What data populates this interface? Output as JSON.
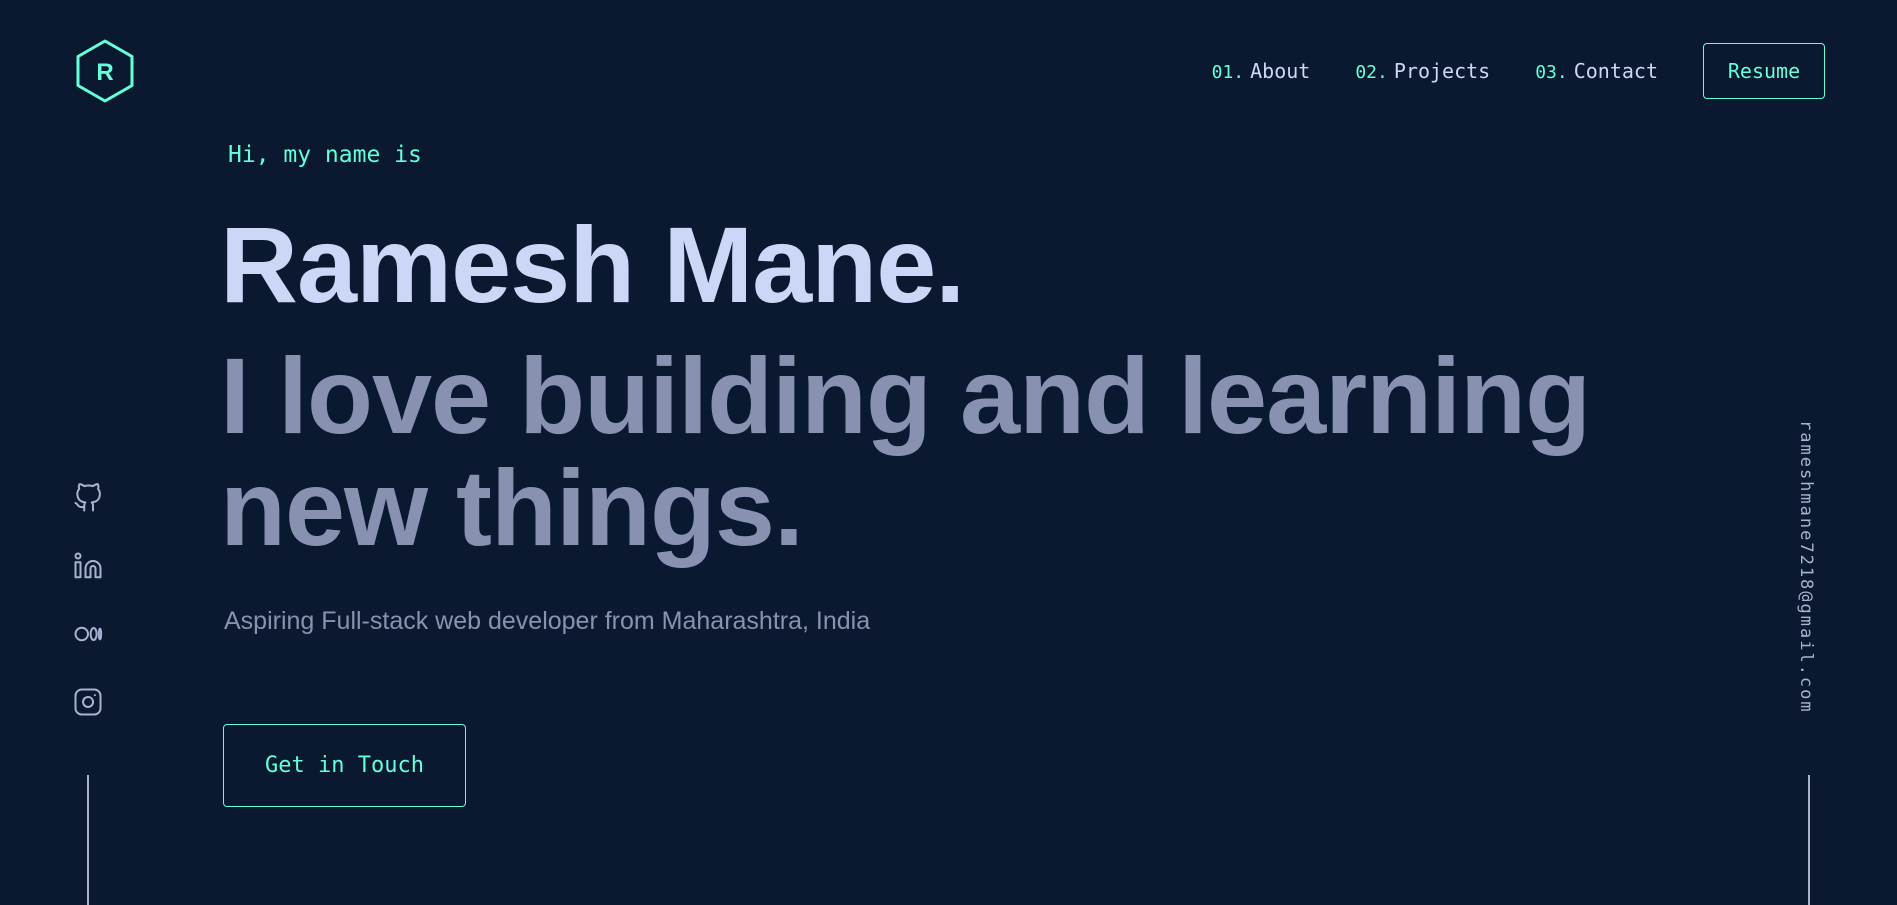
{
  "logo": {
    "letter": "R",
    "icon": "hexagon-logo-icon"
  },
  "nav": {
    "items": [
      {
        "number": "01.",
        "label": "About"
      },
      {
        "number": "02.",
        "label": "Projects"
      },
      {
        "number": "03.",
        "label": "Contact"
      }
    ],
    "resume_label": "Resume"
  },
  "hero": {
    "greeting": "Hi, my name is",
    "name": "Ramesh Mane.",
    "tagline_line1": "I love building and learning",
    "tagline_line2": "new things.",
    "description": "Aspiring Full-stack web developer from Maharashtra, India",
    "cta_label": "Get in Touch"
  },
  "social": {
    "icons": [
      "github-icon",
      "linkedin-icon",
      "medium-icon",
      "instagram-icon"
    ]
  },
  "email": "rameshmane7218@gmail.com",
  "colors": {
    "background": "#0a192f",
    "accent": "#64ffda",
    "heading": "#ccd6f6",
    "muted": "#8892b0"
  }
}
